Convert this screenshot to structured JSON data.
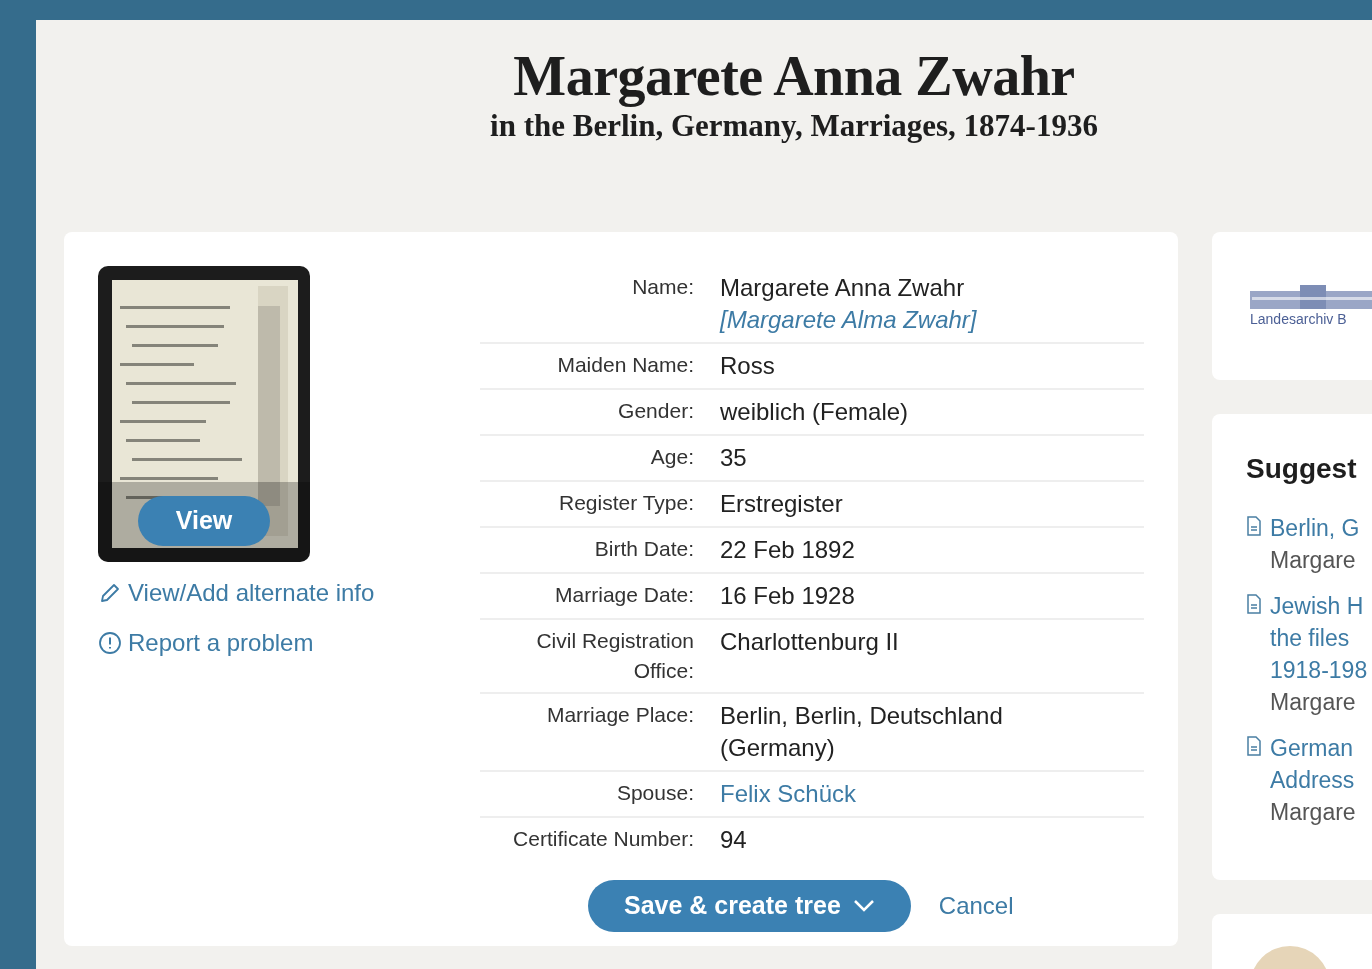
{
  "header": {
    "title": "Margarete Anna Zwahr",
    "subtitle": "in the Berlin, Germany, Marriages, 1874-1936"
  },
  "record_image": {
    "kind": "picture",
    "view_button": "View"
  },
  "side_links": [
    {
      "kind": "edit",
      "label": "View/Add alternate info"
    },
    {
      "kind": "report",
      "label": "Report a problem"
    }
  ],
  "fields": [
    {
      "label": "Name:",
      "values": [
        {
          "kind": "text",
          "text": "Margarete Anna Zwahr"
        },
        {
          "kind": "alternate",
          "text": "[Margarete Alma Zwahr]"
        }
      ]
    },
    {
      "label": "Maiden Name:",
      "values": [
        {
          "kind": "text",
          "text": "Ross"
        }
      ]
    },
    {
      "label": "Gender:",
      "values": [
        {
          "kind": "text",
          "text": "weiblich (Female)"
        }
      ]
    },
    {
      "label": "Age:",
      "values": [
        {
          "kind": "text",
          "text": "35"
        }
      ]
    },
    {
      "label": "Register Type:",
      "values": [
        {
          "kind": "text",
          "text": "Erstregister"
        }
      ]
    },
    {
      "label": "Birth Date:",
      "values": [
        {
          "kind": "text",
          "text": "22 Feb 1892"
        }
      ]
    },
    {
      "label": "Marriage Date:",
      "values": [
        {
          "kind": "text",
          "text": "16 Feb 1928"
        }
      ]
    },
    {
      "label": "Civil Registration Office:",
      "values": [
        {
          "kind": "text",
          "text": "Charlottenburg II"
        }
      ]
    },
    {
      "label": "Marriage Place:",
      "values": [
        {
          "kind": "text",
          "text": "Berlin, Berlin, Deutschland (Germany)"
        }
      ]
    },
    {
      "label": "Spouse:",
      "values": [
        {
          "kind": "link",
          "text": "Felix Schück"
        }
      ]
    },
    {
      "label": "Certificate Number:",
      "values": [
        {
          "kind": "text",
          "text": "94"
        }
      ]
    }
  ],
  "actions": {
    "save": "Save & create tree",
    "cancel": "Cancel"
  },
  "archive_logo": {
    "text": "Landesarchiv B"
  },
  "suggested": {
    "title": "Suggest",
    "items": [
      {
        "lines": [
          "Berlin, G"
        ],
        "name": "Margare"
      },
      {
        "lines": [
          "Jewish H",
          "the files",
          "1918-198"
        ],
        "name": "Margare"
      },
      {
        "lines": [
          "German",
          "Address"
        ],
        "name": "Margare"
      }
    ]
  }
}
